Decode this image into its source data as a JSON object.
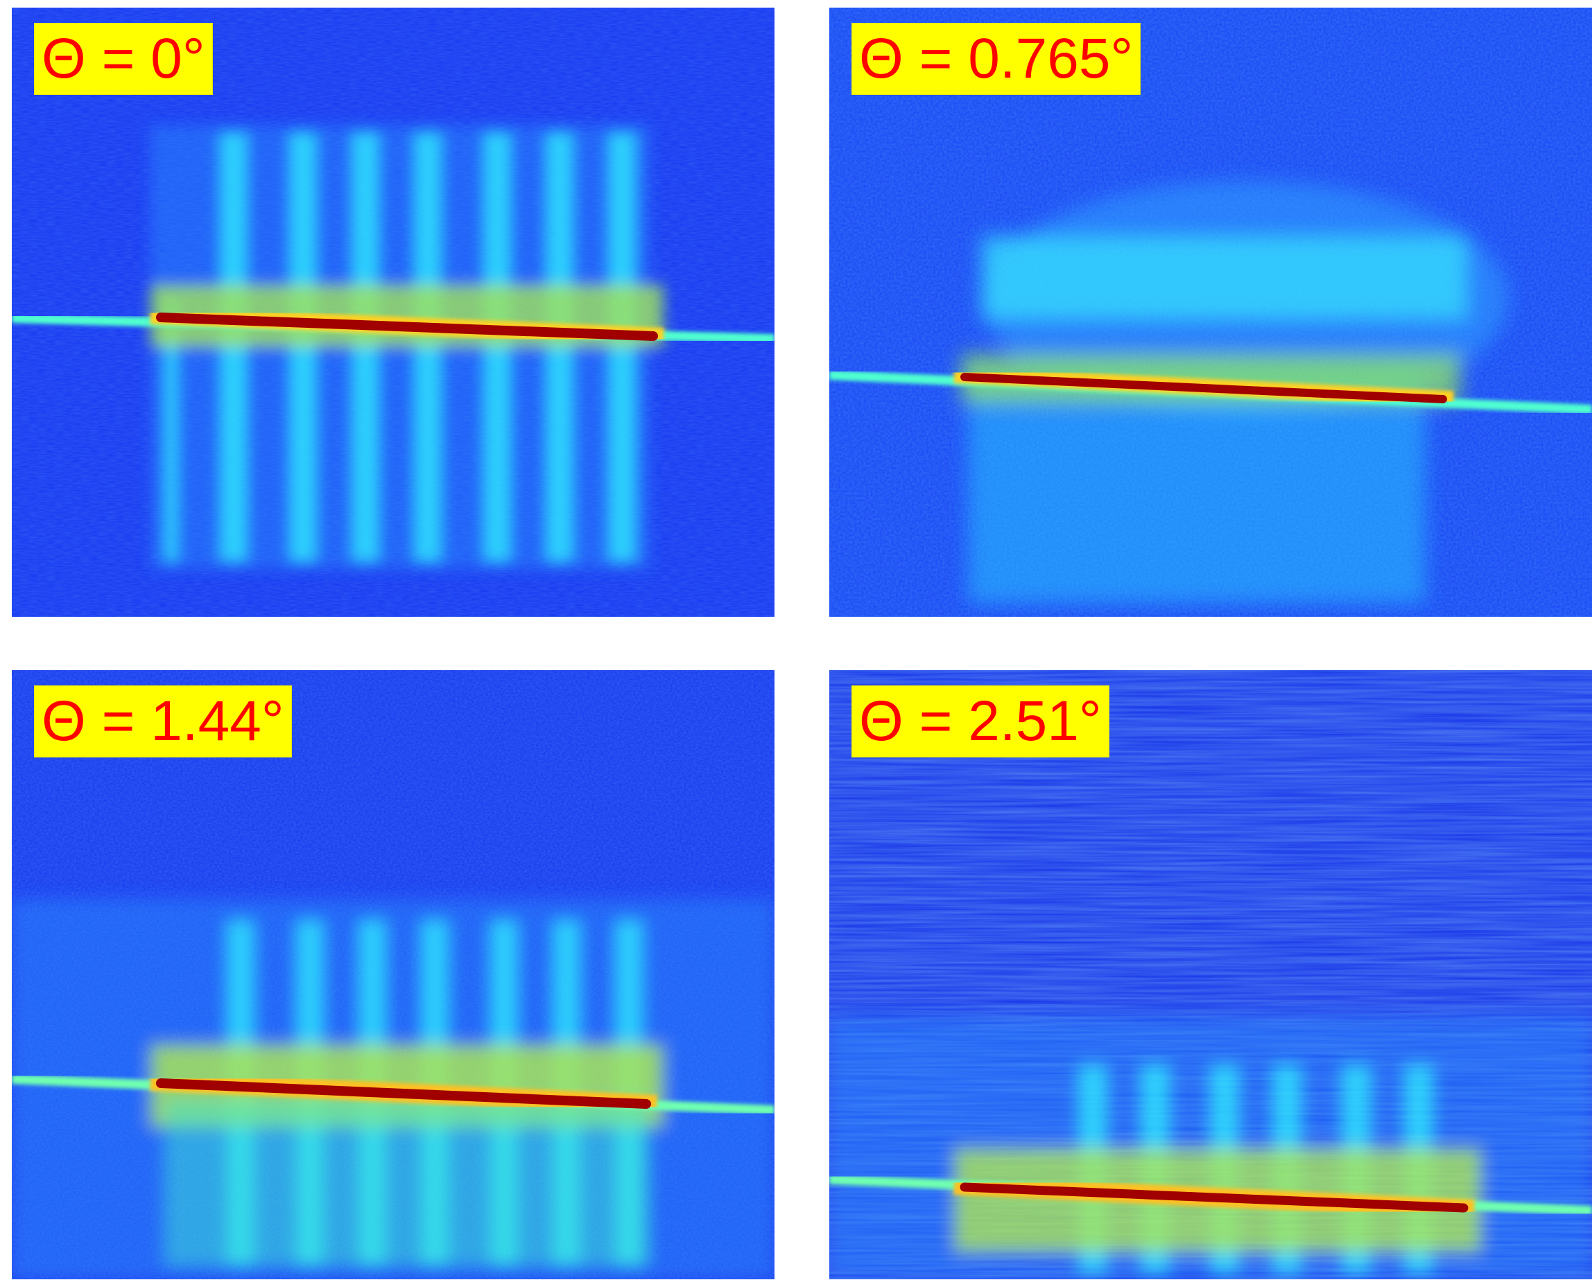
{
  "panels": [
    {
      "label": "Θ = 0°"
    },
    {
      "label": "Θ = 0.765°"
    },
    {
      "label": "Θ = 1.44°"
    },
    {
      "label": "Θ = 2.51°"
    }
  ],
  "colors": {
    "background": "#1a3cff",
    "cyan": "#1ee8ff",
    "yellow": "#e8ff30",
    "red": "#a00000",
    "label_bg": "#ffff00",
    "label_text": "#ff0000"
  }
}
